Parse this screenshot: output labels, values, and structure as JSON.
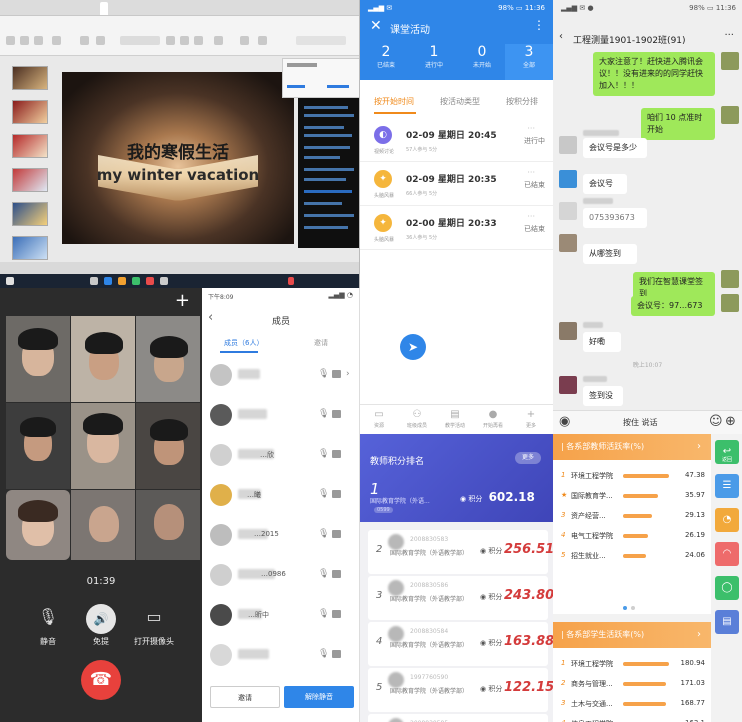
{
  "colors": {
    "accent_blue": "#2f86e8",
    "accent_orange": "#f08a1b",
    "chat_green": "#9fe85a",
    "ranking_purple": "#4a53c8",
    "ranking_red": "#d43b3b",
    "hangup_red": "#e8413c"
  },
  "editor": {
    "slide_title": "我的寒假生活",
    "slide_subtitle": "my winter vacation"
  },
  "video_call": {
    "timer": "01:39",
    "controls": [
      {
        "icon": "microphone-icon",
        "label": "静音"
      },
      {
        "icon": "speaker-icon",
        "label": "免提"
      },
      {
        "icon": "camera-icon",
        "label": "打开摄像头"
      }
    ],
    "hangup_icon": "phone-hangup-icon",
    "plus_icon": "plus-icon"
  },
  "members": {
    "status_time": "下午8:09",
    "title": "成员",
    "tabs": [
      "成员（6人）",
      "邀请"
    ],
    "rows": [
      {
        "name": ""
      },
      {
        "name": ""
      },
      {
        "name": "…欣"
      },
      {
        "name": "…曦"
      },
      {
        "name": "…2015"
      },
      {
        "name": "…0986"
      },
      {
        "name": "…昕中"
      },
      {
        "name": ""
      }
    ],
    "invite_button": "邀请",
    "mute_all_button": "解除静音"
  },
  "activity": {
    "status_time": "11:36",
    "battery": "98%",
    "title": "课堂活动",
    "stats": [
      {
        "num": "2",
        "label": "已结束"
      },
      {
        "num": "1",
        "label": "进行中"
      },
      {
        "num": "0",
        "label": "未开始"
      },
      {
        "num": "3",
        "label": "全部"
      }
    ],
    "sort_tabs": [
      "按开始时间",
      "按活动类型",
      "按积分排"
    ],
    "items": [
      {
        "date": "02-09 星期日 20:45",
        "icon_label": "视频讨论",
        "sub": "57人参与  5分",
        "state": "进行中",
        "color": "#7b6ee8"
      },
      {
        "date": "02-09 星期日 20:35",
        "icon_label": "头脑风暴",
        "sub": "66人参与  5分",
        "state": "已结束",
        "color": "#f5b63c"
      },
      {
        "date": "02-00 星期日 20:33",
        "icon_label": "头脑风暴",
        "sub": "36人参与  5分",
        "state": "已结束",
        "color": "#f5b63c"
      }
    ],
    "nav": [
      {
        "label": "资源"
      },
      {
        "label": "班级成员"
      },
      {
        "label": "教学活动"
      },
      {
        "label": "开始再看"
      },
      {
        "label": "更多"
      }
    ]
  },
  "ranking": {
    "title": "教师积分排名",
    "more": "更多",
    "top": {
      "rank": "1",
      "org": "国际教育学院（外语...",
      "id": "0599",
      "score_label": "积分",
      "score": "602.18"
    },
    "rows": [
      {
        "rank": "2",
        "id": "2008830583",
        "org": "国际教育学院（外语教学部）",
        "score_label": "积分",
        "score": "256.51"
      },
      {
        "rank": "3",
        "id": "2008830586",
        "org": "国际教育学院（外语教学部）",
        "score_label": "积分",
        "score": "243.80"
      },
      {
        "rank": "4",
        "id": "2008830584",
        "org": "国际教育学院（外语教学部）",
        "score_label": "积分",
        "score": "163.88"
      },
      {
        "rank": "5",
        "id": "1997760590",
        "org": "国际教育学院（外语教学部）",
        "score_label": "积分",
        "score": "122.15"
      },
      {
        "rank": "6",
        "id": "2008830585",
        "org": "",
        "score_label": "",
        "score": ""
      }
    ]
  },
  "chat": {
    "status_time": "11:36",
    "battery": "98%",
    "title": "工程测量1901-1902班(91)",
    "time_divider": "晚上10:07",
    "voice_button": "按住 说话",
    "messages": [
      {
        "side": "right",
        "text": "大家注意了！赶快进入腾讯会议！！没有进来的的同学赶快加入！！！"
      },
      {
        "side": "right",
        "text": "咱们 10 点准时开始"
      },
      {
        "side": "left",
        "text": "会议号是多少"
      },
      {
        "side": "left",
        "text": "会议号"
      },
      {
        "side": "left",
        "text": "075393673"
      },
      {
        "side": "left",
        "text": "从哪签到"
      },
      {
        "side": "right",
        "text": "我们在智慧课堂签到"
      },
      {
        "side": "right",
        "text": "会议号：97…673"
      },
      {
        "side": "left",
        "text": "好嘞"
      },
      {
        "side": "left",
        "text": "签到没"
      }
    ]
  },
  "dept": {
    "boards": [
      {
        "title": "| 各系部教师活跃率(%)",
        "rows": [
          {
            "idx": "1",
            "name": "环境工程学院",
            "value": "47.38",
            "fraction": 1.0
          },
          {
            "idx": "★",
            "name": "国际教育学...",
            "value": "35.97",
            "fraction": 0.76
          },
          {
            "idx": "3",
            "name": "资产经营...",
            "value": "29.13",
            "fraction": 0.62
          },
          {
            "idx": "4",
            "name": "电气工程学院",
            "value": "26.19",
            "fraction": 0.55
          },
          {
            "idx": "5",
            "name": "招生就业...",
            "value": "24.06",
            "fraction": 0.51
          }
        ]
      },
      {
        "title": "| 各系部学生活跃率(%)",
        "rows": [
          {
            "idx": "1",
            "name": "环境工程学院",
            "value": "180.94",
            "fraction": 1.0
          },
          {
            "idx": "2",
            "name": "商务与管理...",
            "value": "171.03",
            "fraction": 0.94
          },
          {
            "idx": "3",
            "name": "土木与交通...",
            "value": "168.77",
            "fraction": 0.93
          },
          {
            "idx": "4",
            "name": "信息工程学院",
            "value": "163.1",
            "fraction": 0.9
          }
        ]
      }
    ],
    "side_buttons": [
      {
        "label": "返回",
        "icon": "return-icon",
        "color": "#3cbf6b"
      },
      {
        "label": "",
        "icon": "list-icon",
        "color": "#4b9be8"
      },
      {
        "label": "",
        "icon": "pie-chart-icon",
        "color": "#f2a93b"
      },
      {
        "label": "",
        "icon": "gauge-icon",
        "color": "#ee6b6b"
      },
      {
        "label": "",
        "icon": "refresh-icon",
        "color": "#3cbf6b"
      },
      {
        "label": "",
        "icon": "document-icon",
        "color": "#5a7fd8"
      }
    ]
  }
}
